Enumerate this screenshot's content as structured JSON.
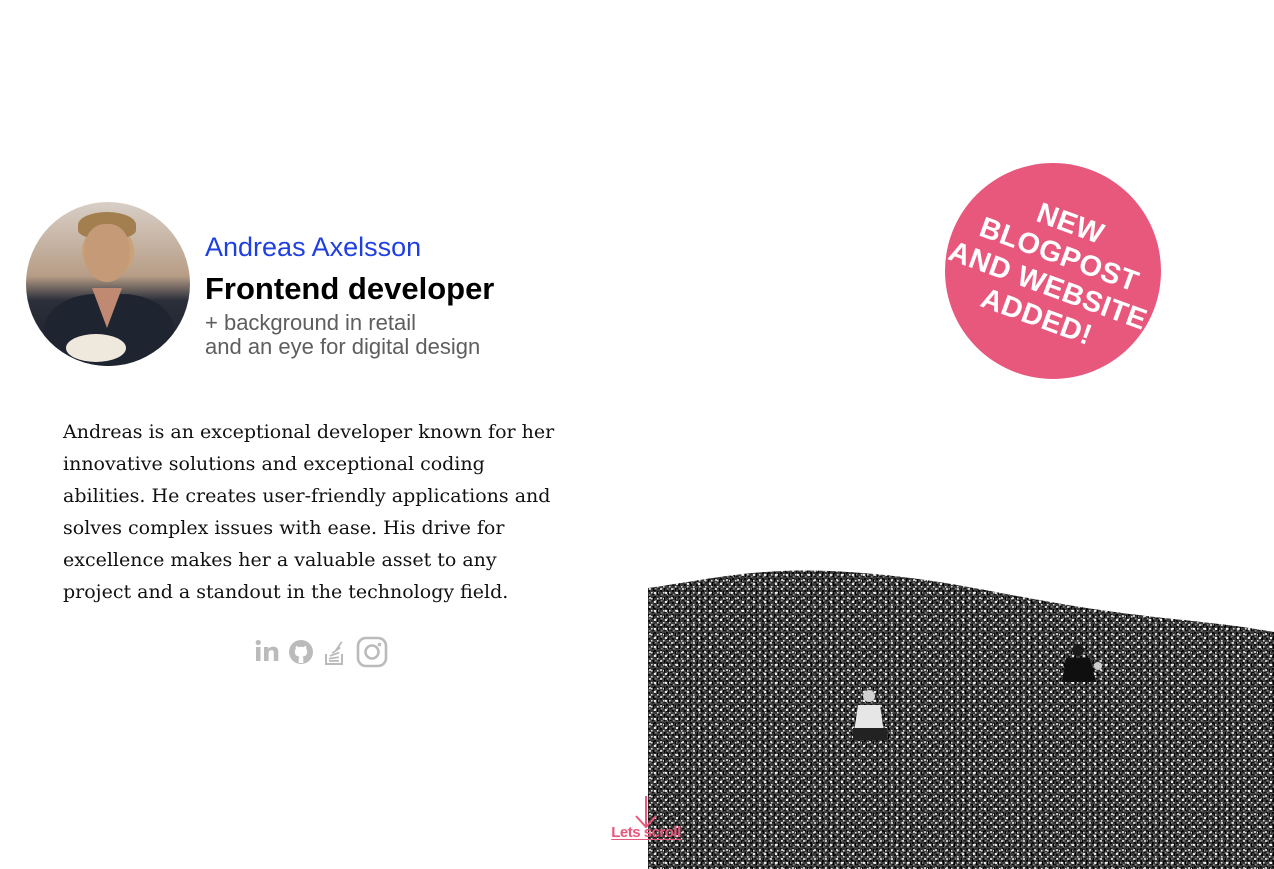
{
  "profile": {
    "name": "Andreas Axelsson",
    "role": "Frontend developer",
    "tagline_1": "+ background in retail",
    "tagline_2": "and an eye for digital design"
  },
  "bio": "Andreas is an exceptional developer known for her innovative solutions and exceptional coding abilities. He creates user-friendly applications and solves complex issues with ease. His drive for excellence makes her a valuable asset to any project and a standout in the technology field.",
  "social": [
    {
      "icon": "linkedin-icon"
    },
    {
      "icon": "github-icon"
    },
    {
      "icon": "stackoverflow-icon"
    },
    {
      "icon": "instagram-icon"
    }
  ],
  "badge": {
    "line1": "NEW",
    "line2": "BLOGPOST",
    "line3": "AND WEBSITE",
    "line4": "ADDED!"
  },
  "scroll": {
    "label": "Lets scroll"
  },
  "colors": {
    "accent": "#e8587c",
    "name": "#1f3fe0",
    "icon": "#bbbbbb"
  }
}
